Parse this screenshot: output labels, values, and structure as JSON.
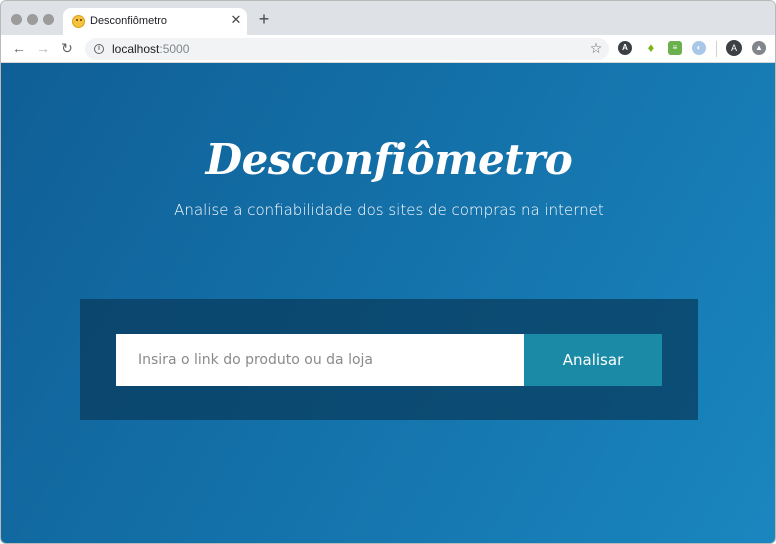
{
  "browser": {
    "tab": {
      "title": "Desconfiômetro",
      "close_glyph": "✕",
      "favicon": "thinking-face-icon"
    },
    "new_tab_glyph": "+",
    "nav": {
      "back": "←",
      "forward": "→",
      "reload": "↻"
    },
    "omnibox": {
      "info_glyph": "i",
      "url_host": "localhost",
      "url_port": ":5000",
      "star_glyph": "☆"
    },
    "extensions": [
      {
        "name": "ext-a-icon",
        "glyph": "A"
      },
      {
        "name": "ext-leaf-icon",
        "glyph": "♦"
      },
      {
        "name": "ext-green-icon",
        "glyph": "≡"
      },
      {
        "name": "ext-blue-icon",
        "glyph": "◐"
      }
    ],
    "profile": {
      "initial": "A"
    },
    "menu_ext_glyph": "▲"
  },
  "page": {
    "logo": "Desconfiômetro",
    "subtitle": "Analise a confiabilidade dos sites de compras na internet",
    "search": {
      "placeholder": "Insira o link do produto ou da loja",
      "value": ""
    },
    "button_label": "Analisar"
  },
  "colors": {
    "accent_button": "#1b8aa6",
    "background_start": "#0f5f96",
    "background_end": "#1a86bf"
  }
}
